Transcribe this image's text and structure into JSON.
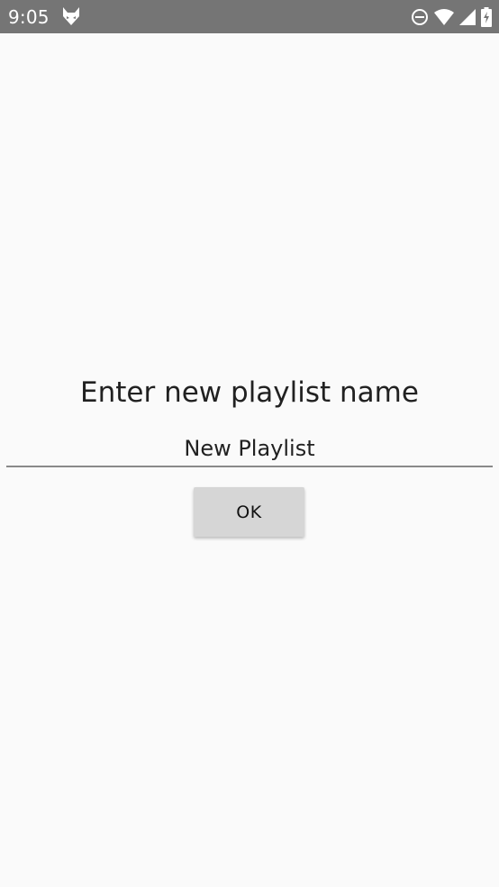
{
  "status_bar": {
    "time": "9:05",
    "icons": [
      "fox-app-icon",
      "do-not-disturb-icon",
      "wifi-icon",
      "signal-icon",
      "battery-icon"
    ],
    "background_color": "#757575"
  },
  "dialog": {
    "title": "Enter new playlist name",
    "input_value": "New Playlist",
    "ok_label": "OK"
  },
  "colors": {
    "background": "#fafafa",
    "button": "#d6d6d6",
    "underline": "#8a8a8a"
  }
}
